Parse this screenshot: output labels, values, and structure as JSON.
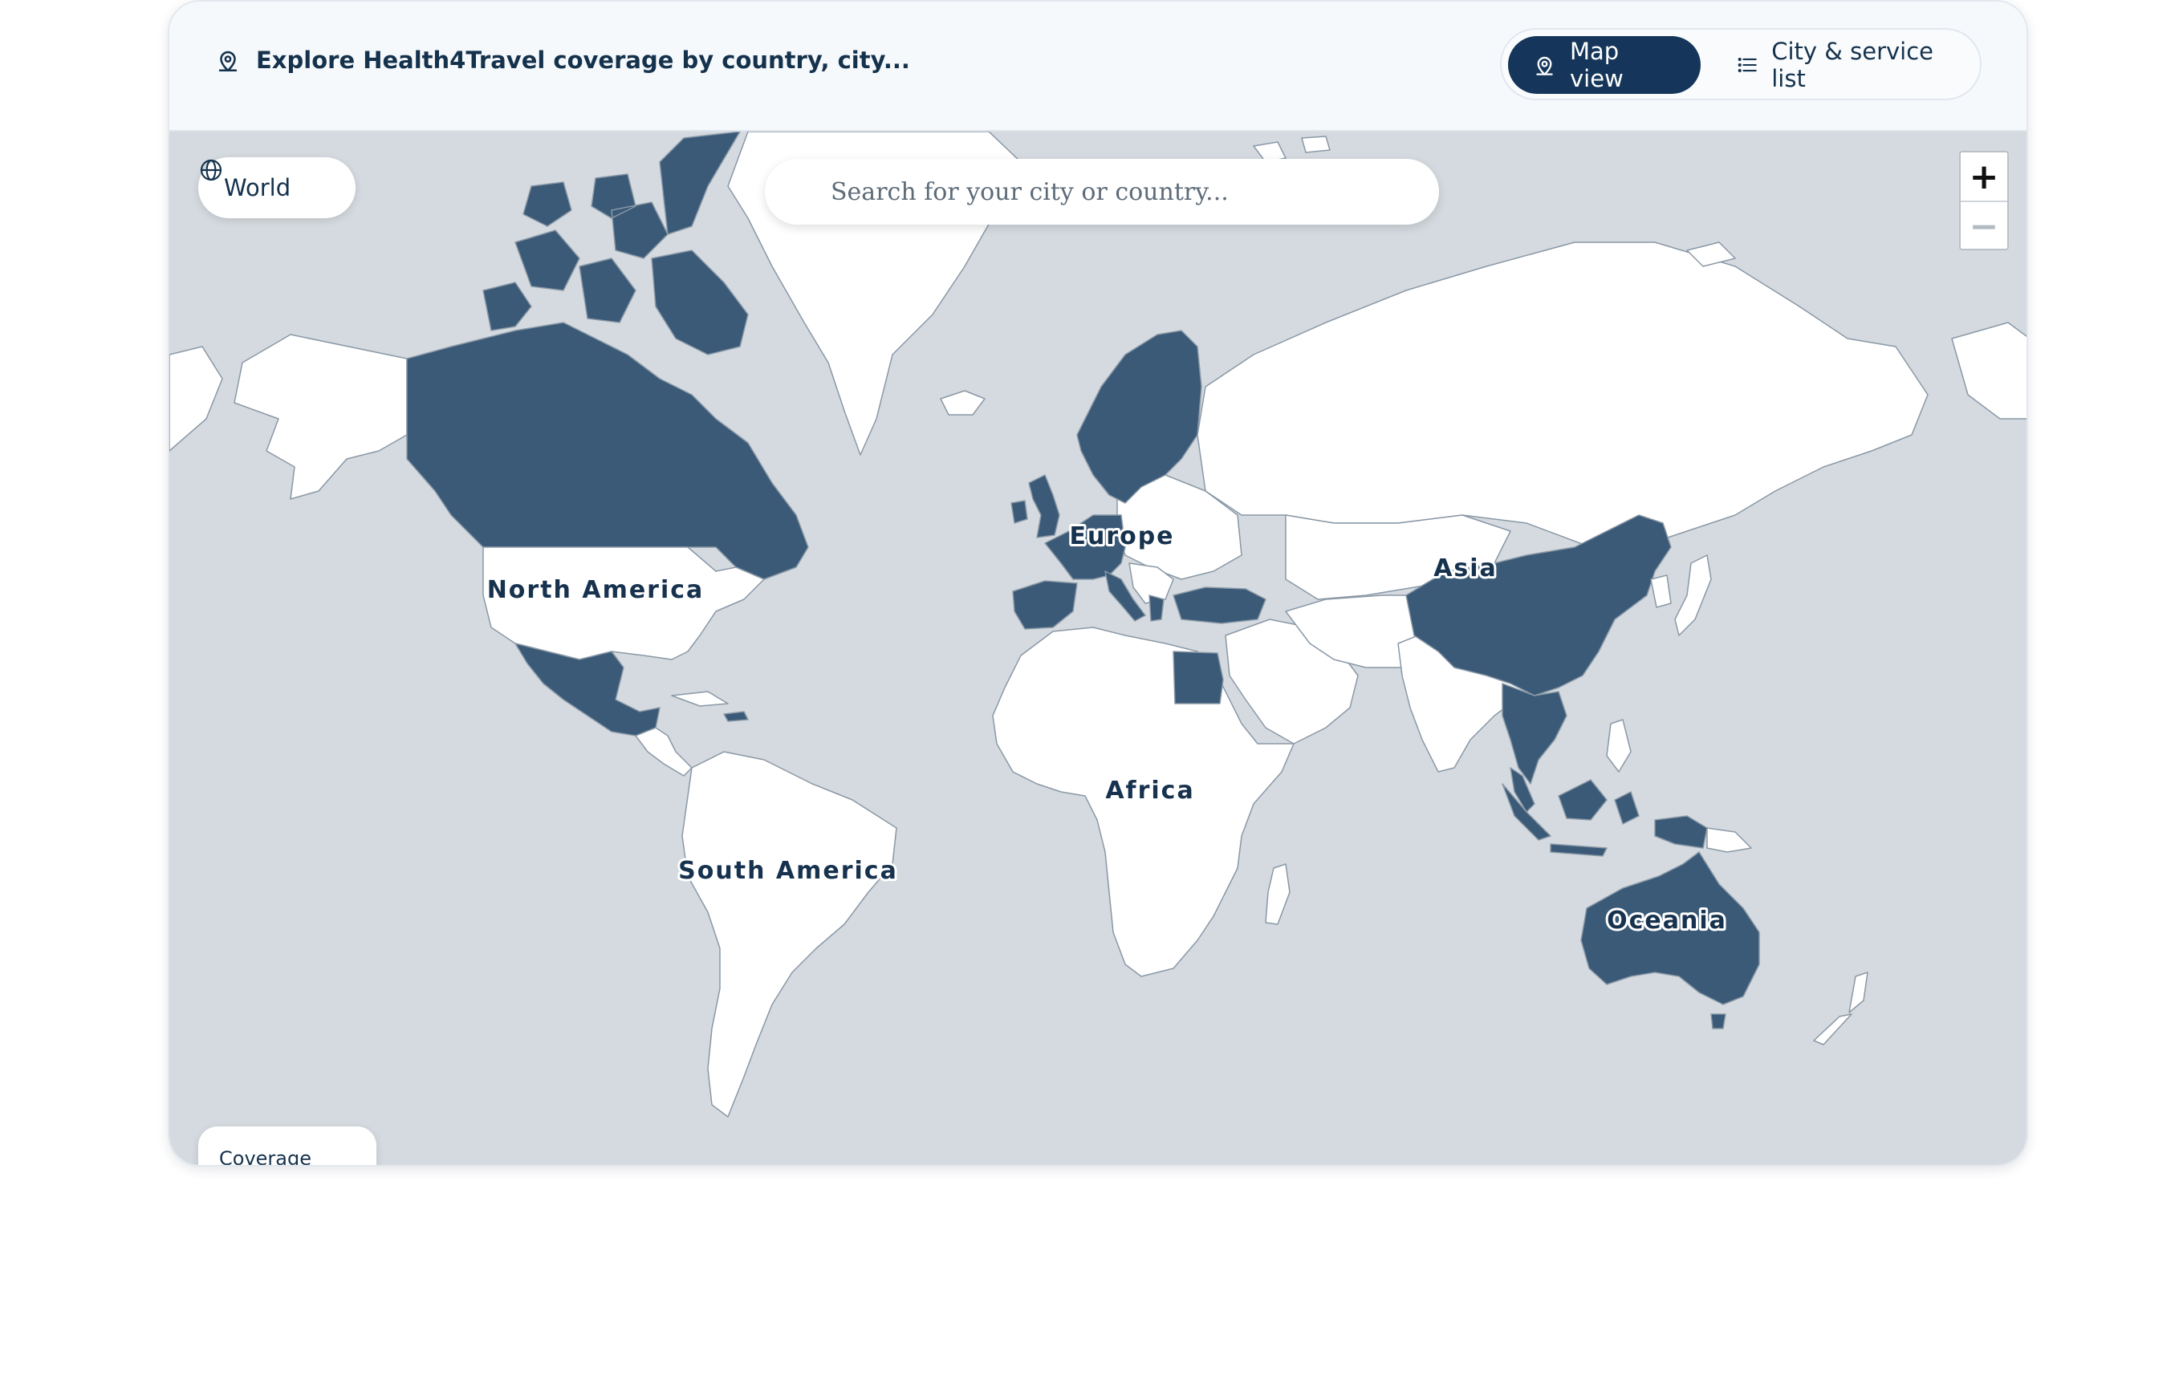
{
  "header": {
    "title": "Explore Health4Travel coverage by country, city...",
    "title_icon": "map-pin-icon",
    "view_toggle": {
      "map_view_label": "Map view",
      "map_view_icon": "map-pin-icon",
      "list_view_label": "City & service list",
      "list_view_icon": "list-icon",
      "active": "Map view"
    }
  },
  "map": {
    "region_button_label": "World",
    "region_button_icon": "globe-icon",
    "search_placeholder": "Search for your city or country...",
    "zoom_in_label": "+",
    "zoom_out_label": "−",
    "legend_title": "Coverage",
    "continent_labels": {
      "north_america": "North America",
      "south_america": "South America",
      "europe": "Europe",
      "africa": "Africa",
      "asia": "Asia",
      "oceania": "Oceania"
    },
    "colors": {
      "ocean": "#d4dadf",
      "land": "#ffffff",
      "covered": "#3a5a78",
      "border": "#8a98a6",
      "label": "#17324e"
    },
    "covered_countries": [
      "Canada",
      "Mexico",
      "United Kingdom",
      "Ireland",
      "Norway",
      "Sweden",
      "Finland",
      "France",
      "Spain",
      "Portugal",
      "Germany",
      "Italy",
      "Greece",
      "Turkey",
      "Egypt",
      "China",
      "Thailand",
      "Vietnam",
      "Malaysia",
      "Indonesia",
      "Australia"
    ]
  }
}
